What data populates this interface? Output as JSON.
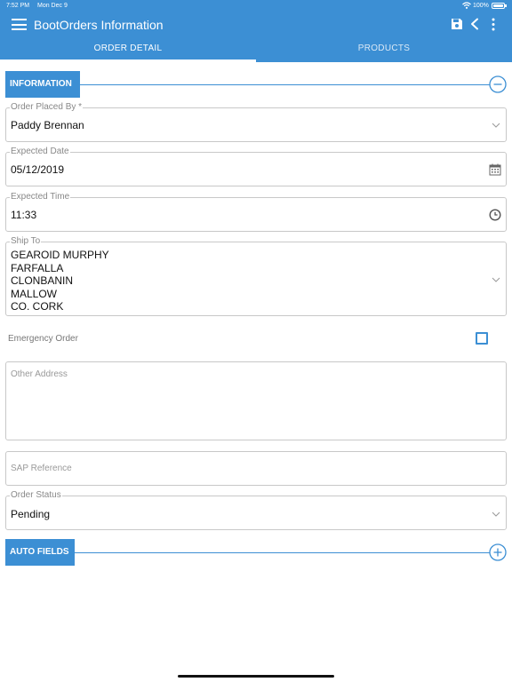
{
  "status_bar": {
    "time": "7:52 PM",
    "date": "Mon Dec 9",
    "battery": "100%"
  },
  "header": {
    "title": "BootOrders Information",
    "icons": [
      "menu-icon",
      "save-icon",
      "back-icon",
      "more-icon"
    ],
    "accent_color": "#3c8fd4"
  },
  "tabs": [
    {
      "label": "ORDER DETAIL",
      "active": true
    },
    {
      "label": "PRODUCTS",
      "active": false
    }
  ],
  "sections": {
    "information": {
      "label": "INFORMATION",
      "toggle_icon": "collapse-minus-icon"
    },
    "auto_fields": {
      "label": "AUTO FIELDS",
      "toggle_icon": "expand-plus-icon"
    }
  },
  "form": {
    "order_placed_by": {
      "label": "Order Placed By *",
      "value": "Paddy Brennan"
    },
    "expected_date": {
      "label": "Expected Date",
      "value": "05/12/2019",
      "icon": "calendar-icon"
    },
    "expected_time": {
      "label": "Expected Time",
      "value": "11:33",
      "icon": "clock-icon"
    },
    "ship_to": {
      "label": "Ship To",
      "lines": [
        "GEAROID MURPHY",
        "FARFALLA",
        "CLONBANIN",
        "MALLOW",
        "CO. CORK"
      ]
    },
    "emergency_order": {
      "label": "Emergency Order",
      "checked": false
    },
    "other_address": {
      "placeholder": "Other Address",
      "value": ""
    },
    "sap_reference": {
      "placeholder": "SAP Reference",
      "value": ""
    },
    "order_status": {
      "label": "Order Status",
      "value": "Pending"
    }
  }
}
